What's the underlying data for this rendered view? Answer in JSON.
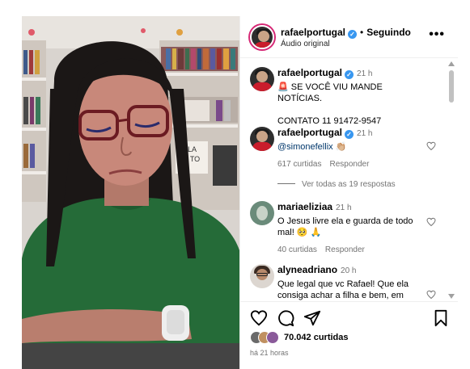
{
  "post": {
    "author": "rafaelportugal",
    "verified_badge": "verified-icon",
    "dot": "•",
    "following_label": "Seguindo",
    "audio_label": "Áudio original",
    "more_label": "•••"
  },
  "comments": [
    {
      "user": "rafaelportugal",
      "time": "21 h",
      "text_line1": "🚨 SE VOCÊ VIU MANDE NOTÍCIAS.",
      "text_line2": "CONTATO 11 91472-9547"
    },
    {
      "user": "rafaelportugal",
      "time": "21 h",
      "text": "@simonefellix 👏🏼",
      "likes": "617 curtidas",
      "reply": "Responder"
    },
    {
      "view_replies": "Ver todas as 19 respostas"
    },
    {
      "user": "mariaeliziaa",
      "time": "21 h",
      "text": "O Jesus livre ela e guarda de todo mal! 🥺 🙏",
      "likes": "40 curtidas",
      "reply": "Responder"
    },
    {
      "user": "alyneadriano",
      "time": "20 h",
      "text": "Que legal que vc Rafael! Que ela consiga achar a filha e bem, em"
    }
  ],
  "footer": {
    "likes": "70.042 curtidas",
    "posted": "há 21 horas"
  },
  "icons": [
    "heart-icon",
    "comment-icon",
    "share-icon",
    "bookmark-icon",
    "more-options-icon"
  ]
}
